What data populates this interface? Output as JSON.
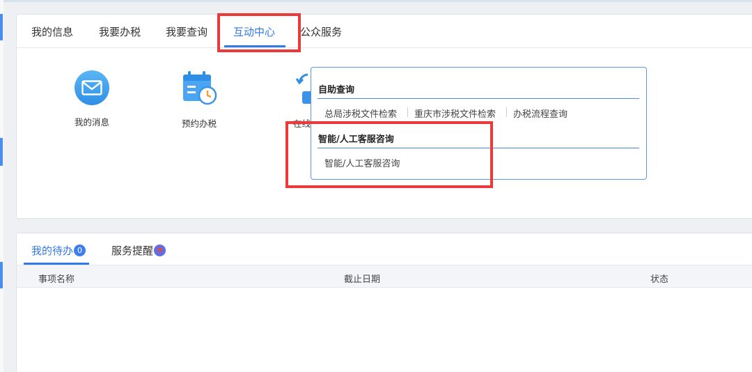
{
  "top_tabs": [
    {
      "label": "我的信息",
      "active": false
    },
    {
      "label": "我要办税",
      "active": false
    },
    {
      "label": "我要查询",
      "active": false
    },
    {
      "label": "互动中心",
      "active": true
    },
    {
      "label": "公众服务",
      "active": false
    }
  ],
  "tools": [
    {
      "label": "我的消息",
      "icon": "mail-icon"
    },
    {
      "label": "预约办税",
      "icon": "calendar-clock-icon"
    },
    {
      "label": "在线",
      "icon": "refresh-icon"
    }
  ],
  "dropdown": {
    "sections": [
      {
        "title": "自助查询",
        "links": [
          "总局涉税文件检索",
          "重庆市涉税文件检索",
          "办税流程查询"
        ]
      },
      {
        "title": "智能/人工客服咨询",
        "links": [
          "智能/人工客服咨询"
        ]
      }
    ]
  },
  "bottom_tabs": [
    {
      "label": "我的待办",
      "badge": "0",
      "active": true
    },
    {
      "label": "服务提醒",
      "badge": "9",
      "active": false
    }
  ],
  "table": {
    "columns": [
      "事项名称",
      "截止日期",
      "状态"
    ]
  },
  "colors": {
    "accent": "#2f78e6",
    "highlight": "#ec3a3a",
    "background": "#eef0f4"
  }
}
